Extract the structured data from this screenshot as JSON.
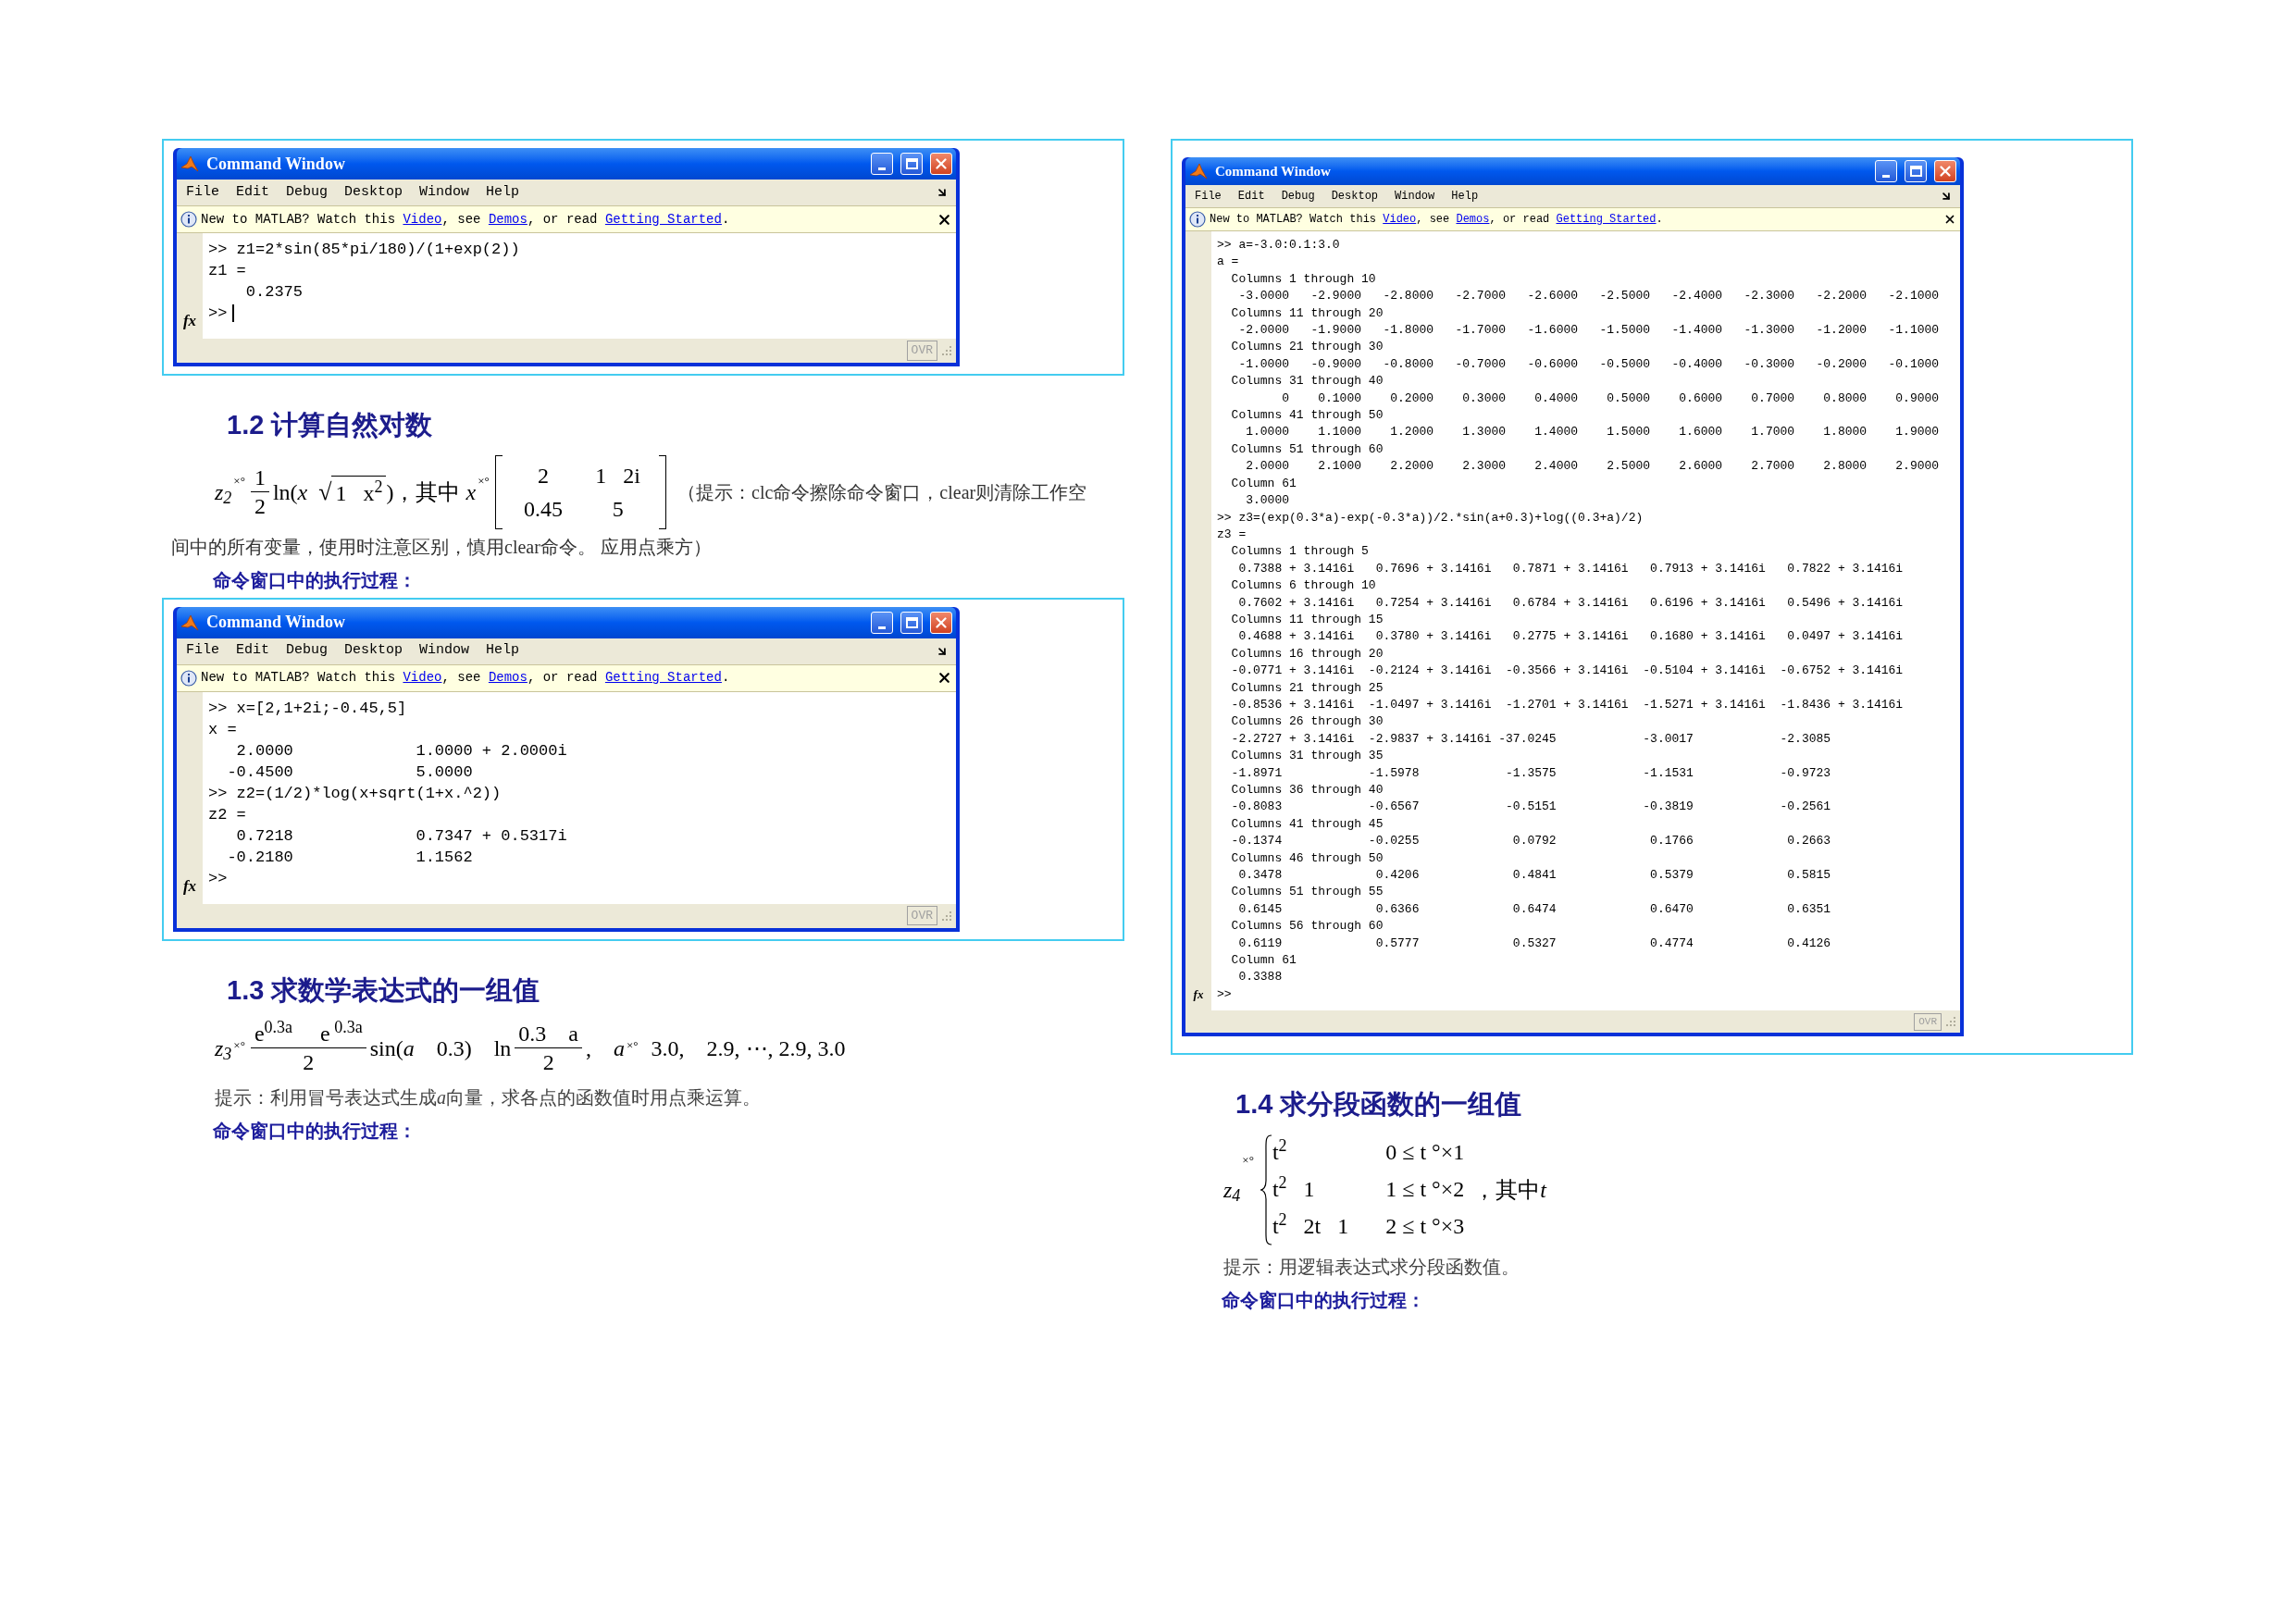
{
  "left_column": [
    {
      "kind": "window",
      "title": "Command Window",
      "menu": [
        "File",
        "Edit",
        "Debug",
        "Desktop",
        "Window",
        "Help"
      ],
      "info": [
        {
          "kind": "text",
          "text": "New to MATLAB? Watch this "
        },
        {
          "kind": "link",
          "text": "Video"
        },
        {
          "kind": "text",
          "text": ", see "
        },
        {
          "kind": "link",
          "text": "Demos"
        },
        {
          "kind": "text",
          "text": ", or read "
        },
        {
          "kind": "link",
          "text": "Getting Started"
        },
        {
          "kind": "text",
          "text": "."
        }
      ],
      "lines": [
        ">> z1=2*sin(85*pi/180)/(1+exp(2))",
        "z1 =",
        "    0.2375"
      ],
      "fx": "fx",
      "prompt": ">>",
      "cursor": true,
      "status": "OVR"
    },
    {
      "kind": "heading",
      "text": "1.2 计算自然对数"
    },
    {
      "kind": "formula",
      "tokens": [
        {
          "kind": "text",
          "text": "z$_{2}$",
          "italic": true
        },
        {
          "kind": "mark",
          "text": "×°"
        },
        {
          "kind": "frac",
          "num": "1",
          "den": "2"
        },
        {
          "kind": "text",
          "text": "ln(",
          "italic": false
        },
        {
          "kind": "text",
          "text": "x",
          "italic": true
        },
        {
          "kind": "sqrt",
          "root": "√",
          "text": "1   x$^{2}$"
        },
        {
          "kind": "text",
          "text": ")，其中 ",
          "italic": false
        },
        {
          "kind": "text",
          "text": "x",
          "italic": true
        },
        {
          "kind": "mark",
          "text": "×°"
        },
        {
          "kind": "matrix",
          "rows": [
            [
              "2",
              "1   2i"
            ],
            [
              "0.45",
              "5"
            ]
          ]
        },
        {
          "kind": "note",
          "text": "（提示：clc命令擦除命令窗口，clear则清除工作空"
        }
      ]
    },
    {
      "kind": "continuation",
      "parts": [
        {
          "text": "间中的所有变量，使用时注意区别，慎用clear命令。 应用点乘方）",
          "italic": false
        }
      ]
    },
    {
      "kind": "label",
      "text": "命令窗口中的执行过程："
    },
    {
      "kind": "window",
      "title": "Command Window",
      "menu": [
        "File",
        "Edit",
        "Debug",
        "Desktop",
        "Window",
        "Help"
      ],
      "info": [
        {
          "kind": "text",
          "text": "New to MATLAB? Watch this "
        },
        {
          "kind": "link",
          "text": "Video"
        },
        {
          "kind": "text",
          "text": ", see "
        },
        {
          "kind": "link",
          "text": "Demos"
        },
        {
          "kind": "text",
          "text": ", or read "
        },
        {
          "kind": "link",
          "text": "Getting Started"
        },
        {
          "kind": "text",
          "text": "."
        }
      ],
      "lines": [
        ">> x=[2,1+2i;-0.45,5]",
        "x =",
        "   2.0000             1.0000 + 2.0000i",
        "  -0.4500             5.0000",
        ">> z2=(1/2)*log(x+sqrt(1+x.^2))",
        "z2 =",
        "   0.7218             0.7347 + 0.5317i",
        "  -0.2180             1.1562"
      ],
      "fx": "fx",
      "prompt": ">>",
      "cursor": false,
      "status": "OVR"
    },
    {
      "kind": "heading",
      "text": "1.3 求数学表达式的一组值"
    },
    {
      "kind": "formula",
      "tokens": [
        {
          "kind": "text",
          "text": "z$_{3}$",
          "italic": true
        },
        {
          "kind": "mark",
          "text": "×°"
        },
        {
          "kind": "frac",
          "num": "e$^{0.3a}$     e$^{ 0.3a}$",
          "den": "2"
        },
        {
          "kind": "text",
          "text": "sin(",
          "italic": false
        },
        {
          "kind": "text",
          "text": "a",
          "italic": true
        },
        {
          "kind": "text",
          "text": "    0.3)    ln",
          "italic": false
        },
        {
          "kind": "frac",
          "num": "0.3    a",
          "den": "2"
        },
        {
          "kind": "text",
          "text": ",    ",
          "italic": false
        },
        {
          "kind": "text",
          "text": "a",
          "italic": true
        },
        {
          "kind": "mark",
          "text": "×°"
        },
        {
          "kind": "text",
          "text": "  3.0,    2.9, ⋯, 2.9, 3.0",
          "italic": false
        }
      ]
    },
    {
      "kind": "hint",
      "parts": [
        {
          "text": "提示：利用冒号表达式生成",
          "italic": false
        },
        {
          "text": "a",
          "italic": true
        },
        {
          "text": "向量，求各点的函数值时用点乘运算。",
          "italic": false
        }
      ]
    },
    {
      "kind": "label",
      "text": "命令窗口中的执行过程："
    }
  ],
  "right_column": [
    {
      "kind": "window",
      "title": "Command Window",
      "menu": [
        "File",
        "Edit",
        "Debug",
        "Desktop",
        "Window",
        "Help"
      ],
      "info": [
        {
          "kind": "text",
          "text": "New to MATLAB? Watch this "
        },
        {
          "kind": "link",
          "text": "Video"
        },
        {
          "kind": "text",
          "text": ", see "
        },
        {
          "kind": "link",
          "text": "Demos"
        },
        {
          "kind": "text",
          "text": ", or read "
        },
        {
          "kind": "link",
          "text": "Getting Started"
        },
        {
          "kind": "text",
          "text": "."
        }
      ],
      "lines": [
        ">> a=-3.0:0.1:3.0",
        "a =",
        "  Columns 1 through 10",
        "   -3.0000   -2.9000   -2.8000   -2.7000   -2.6000   -2.5000   -2.4000   -2.3000   -2.2000   -2.1000",
        "  Columns 11 through 20",
        "   -2.0000   -1.9000   -1.8000   -1.7000   -1.6000   -1.5000   -1.4000   -1.3000   -1.2000   -1.1000",
        "  Columns 21 through 30",
        "   -1.0000   -0.9000   -0.8000   -0.7000   -0.6000   -0.5000   -0.4000   -0.3000   -0.2000   -0.1000",
        "  Columns 31 through 40",
        "         0    0.1000    0.2000    0.3000    0.4000    0.5000    0.6000    0.7000    0.8000    0.9000",
        "  Columns 41 through 50",
        "    1.0000    1.1000    1.2000    1.3000    1.4000    1.5000    1.6000    1.7000    1.8000    1.9000",
        "  Columns 51 through 60",
        "    2.0000    2.1000    2.2000    2.3000    2.4000    2.5000    2.6000    2.7000    2.8000    2.9000",
        "  Column 61",
        "    3.0000",
        ">> z3=(exp(0.3*a)-exp(-0.3*a))/2.*sin(a+0.3)+log((0.3+a)/2)",
        "z3 =",
        "  Columns 1 through 5",
        "   0.7388 + 3.1416i   0.7696 + 3.1416i   0.7871 + 3.1416i   0.7913 + 3.1416i   0.7822 + 3.1416i",
        "  Columns 6 through 10",
        "   0.7602 + 3.1416i   0.7254 + 3.1416i   0.6784 + 3.1416i   0.6196 + 3.1416i   0.5496 + 3.1416i",
        "  Columns 11 through 15",
        "   0.4688 + 3.1416i   0.3780 + 3.1416i   0.2775 + 3.1416i   0.1680 + 3.1416i   0.0497 + 3.1416i",
        "  Columns 16 through 20",
        "  -0.0771 + 3.1416i  -0.2124 + 3.1416i  -0.3566 + 3.1416i  -0.5104 + 3.1416i  -0.6752 + 3.1416i",
        "  Columns 21 through 25",
        "  -0.8536 + 3.1416i  -1.0497 + 3.1416i  -1.2701 + 3.1416i  -1.5271 + 3.1416i  -1.8436 + 3.1416i",
        "  Columns 26 through 30",
        "  -2.2727 + 3.1416i  -2.9837 + 3.1416i -37.0245            -3.0017            -2.3085",
        "  Columns 31 through 35",
        "  -1.8971            -1.5978            -1.3575            -1.1531            -0.9723",
        "  Columns 36 through 40",
        "  -0.8083            -0.6567            -0.5151            -0.3819            -0.2561",
        "  Columns 41 through 45",
        "  -0.1374            -0.0255             0.0792             0.1766             0.2663",
        "  Columns 46 through 50",
        "   0.3478             0.4206             0.4841             0.5379             0.5815",
        "  Columns 51 through 55",
        "   0.6145             0.6366             0.6474             0.6470             0.6351",
        "  Columns 56 through 60",
        "   0.6119             0.5777             0.5327             0.4774             0.4126",
        "  Column 61",
        "   0.3388"
      ],
      "fx": "fx",
      "prompt": ">>",
      "cursor": false,
      "status": "OVR"
    },
    {
      "kind": "heading",
      "text": "1.4 求分段函数的一组值"
    },
    {
      "kind": "formula",
      "tokens": [
        {
          "kind": "text",
          "text": "z$_{4}$",
          "italic": true
        },
        {
          "kind": "mark",
          "text": "×°"
        },
        {
          "kind": "cases",
          "rows": [
            {
              "expr": "t$^{2}$",
              "cond": "0 ≤ t °×1"
            },
            {
              "expr": "t$^{2}$   1",
              "cond": "1 ≤ t °×2"
            },
            {
              "expr": "t$^{2}$   2t   1",
              "cond": "2 ≤ t °×3"
            }
          ]
        },
        {
          "kind": "text",
          "text": " ，其中",
          "italic": false
        },
        {
          "kind": "text",
          "text": "t",
          "italic": true
        }
      ]
    },
    {
      "kind": "hint",
      "parts": [
        {
          "text": "提示：用逻辑表达式求分段函数值。",
          "italic": false
        }
      ]
    },
    {
      "kind": "label",
      "text": "命令窗口中的执行过程："
    }
  ]
}
